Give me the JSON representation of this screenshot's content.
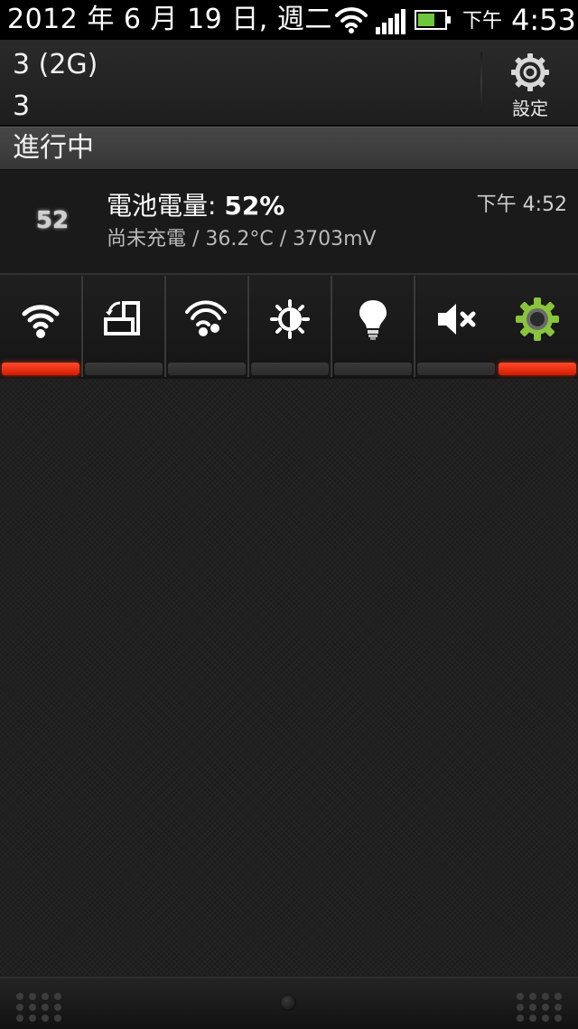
{
  "status_bar": {
    "date": "2012 年 6 月 19 日, 週二",
    "ampm": "下午",
    "time": "4:53",
    "icons": [
      "wifi-icon",
      "signal-icon",
      "battery-icon"
    ],
    "battery_color": "#6cc83a"
  },
  "header": {
    "carrier_line1": "3 (2G)",
    "carrier_line2": "3",
    "settings_label": "設定"
  },
  "ongoing": {
    "title": "進行中"
  },
  "notification": {
    "icon_text": "52",
    "title_prefix": "電池電量: ",
    "title_value": "52%",
    "subtitle": "尚未充電 / 36.2°C / 3703mV",
    "time": "下午 4:52"
  },
  "toggles": [
    {
      "name": "wifi",
      "icon": "wifi-icon",
      "on": true
    },
    {
      "name": "auto-rotate",
      "icon": "rotate-icon",
      "on": false
    },
    {
      "name": "wifi-hotspot",
      "icon": "hotspot-icon",
      "on": false
    },
    {
      "name": "brightness",
      "icon": "brightness-icon",
      "on": false
    },
    {
      "name": "flashlight",
      "icon": "lightbulb-icon",
      "on": false
    },
    {
      "name": "sound",
      "icon": "mute-icon",
      "on": false
    },
    {
      "name": "settings",
      "icon": "gear-icon",
      "on": true
    }
  ],
  "colors": {
    "toggle_on": "#e8200a",
    "toggle_off": "#333333",
    "gear_green": "#8ac43c"
  }
}
